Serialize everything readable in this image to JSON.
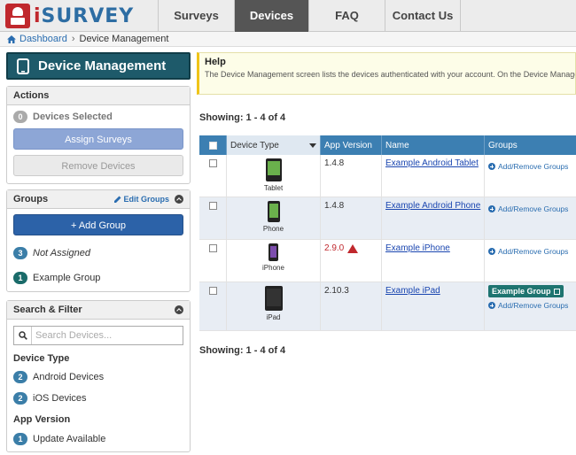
{
  "app": {
    "name_prefix": "i",
    "name_main": "SURVEY"
  },
  "nav": {
    "surveys": "Surveys",
    "devices": "Devices",
    "faq": "FAQ",
    "contact": "Contact Us"
  },
  "breadcrumb": {
    "dashboard": "Dashboard",
    "current": "Device Management"
  },
  "page_title": "Device Management",
  "actions": {
    "title": "Actions",
    "selected_count": "0",
    "selected_label": "Devices Selected",
    "assign": "Assign Surveys",
    "remove": "Remove Devices"
  },
  "groups": {
    "title": "Groups",
    "edit": "Edit Groups",
    "add": "+ Add Group",
    "items": [
      {
        "count": "3",
        "label": "Not Assigned"
      },
      {
        "count": "1",
        "label": "Example Group"
      }
    ]
  },
  "search": {
    "title": "Search & Filter",
    "placeholder": "Search Devices...",
    "device_type_heading": "Device Type",
    "device_types": [
      {
        "count": "2",
        "label": "Android Devices"
      },
      {
        "count": "2",
        "label": "iOS Devices"
      }
    ],
    "app_version_heading": "App Version",
    "app_versions": [
      {
        "count": "1",
        "label": "Update Available"
      }
    ]
  },
  "help": {
    "title": "Help",
    "text": "The Device Management screen lists the devices authenticated with your account. On the Device Manager"
  },
  "showing": "Showing: 1 - 4 of 4",
  "table": {
    "headers": {
      "device_type": "Device Type",
      "app_version": "App Version",
      "name": "Name",
      "groups": "Groups"
    },
    "add_remove_label": "Add/Remove Groups",
    "rows": [
      {
        "type": "Tablet",
        "version": "1.4.8",
        "name": "Example Android Tablet",
        "group": ""
      },
      {
        "type": "Phone",
        "version": "1.4.8",
        "name": "Example Android Phone",
        "group": ""
      },
      {
        "type": "iPhone",
        "version": "2.9.0",
        "name": "Example iPhone",
        "group": ""
      },
      {
        "type": "iPad",
        "version": "2.10.3",
        "name": "Example iPad",
        "group": "Example Group"
      }
    ]
  },
  "colors": {
    "accent": "#1e5a6a",
    "header_blue": "#3c7fb2",
    "brand_red": "#c0282d",
    "brand_blue": "#2d6da3"
  }
}
